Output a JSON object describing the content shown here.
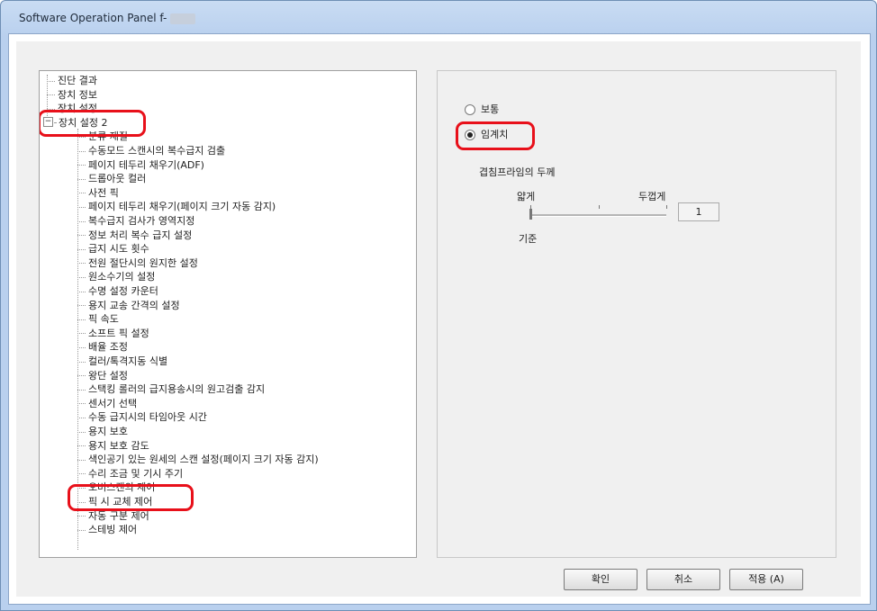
{
  "window": {
    "title": "Software Operation Panel f-"
  },
  "tree": {
    "items": [
      "진단 결과",
      "장치 정보",
      "장치 설정",
      "장치 설정 2",
      "분류 재질",
      "수동모드 스캔시의 복수급지 검출",
      "페이지 테두리 채우기(ADF)",
      "드롭아웃 컬러",
      "사전 픽",
      "페이지 테두리 채우기(페이지 크기 자동 감지)",
      "복수급지 검사가 영역지정",
      "정보 처리 복수 급지 설정",
      "급지 시도 횟수",
      "전원 절단시의 원지한 설정",
      "원소수기의 설정",
      "수명 설정 카운터",
      "용지 교송 간격의 설정",
      "픽 속도",
      "소프트 픽 설정",
      "배율 조정",
      "컬러/톡격지동 식별",
      "왕단 설정",
      "스택킹 롤러의 급지용송시의 원고검출 감지",
      "센서기 선택",
      "수동 급지시의 타임아웃 시간",
      "용지 보호",
      "용지 보호 감도",
      "색인공기 있는 원세의 스캔 설정(페이지 크기 자동 감지)",
      "수리 조금 및 기시 주기",
      "오버스캔의 제어",
      "픽 시 교체 제어",
      "자동 구분 제어",
      "스테빙 제어"
    ]
  },
  "settings": {
    "option_normal": "보통",
    "option_specify": "임계치",
    "thickness_label": "겹침프라임의 두께",
    "thin_label": "얇게",
    "thick_label": "두껍게",
    "default_label": "기준",
    "slider_value": "1"
  },
  "buttons": {
    "ok": "확인",
    "cancel": "취소",
    "apply": "적용 (A)"
  }
}
